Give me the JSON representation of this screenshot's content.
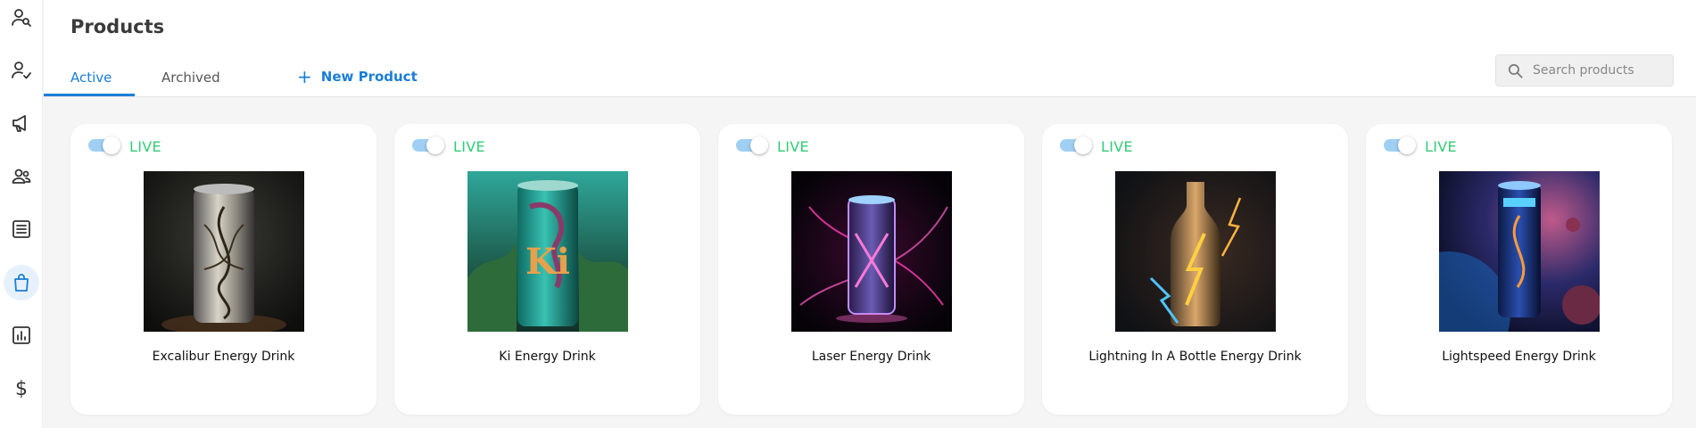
{
  "sidebar": {
    "items": [
      {
        "name": "user-search-icon"
      },
      {
        "name": "user-check-icon"
      },
      {
        "name": "megaphone-icon"
      },
      {
        "name": "users-icon"
      },
      {
        "name": "document-icon"
      },
      {
        "name": "shopping-bag-icon",
        "active": true
      },
      {
        "name": "bar-chart-icon"
      },
      {
        "name": "dollar-icon",
        "glyph": "$"
      }
    ]
  },
  "header": {
    "title": "Products",
    "tabs": [
      {
        "label": "Active",
        "active": true
      },
      {
        "label": "Archived",
        "active": false
      }
    ],
    "new_product_label": "New Product",
    "new_product_icon": "+",
    "search": {
      "placeholder": "Search products",
      "value": ""
    }
  },
  "accent_color": "#1a7ed6",
  "live_color": "#33cc77",
  "products": [
    {
      "name": "Excalibur Energy Drink",
      "status": "LIVE",
      "live": true
    },
    {
      "name": "Ki Energy Drink",
      "status": "LIVE",
      "live": true
    },
    {
      "name": "Laser Energy Drink",
      "status": "LIVE",
      "live": true
    },
    {
      "name": "Lightning In A Bottle Energy Drink",
      "status": "LIVE",
      "live": true
    },
    {
      "name": "Lightspeed Energy Drink",
      "status": "LIVE",
      "live": true
    }
  ]
}
